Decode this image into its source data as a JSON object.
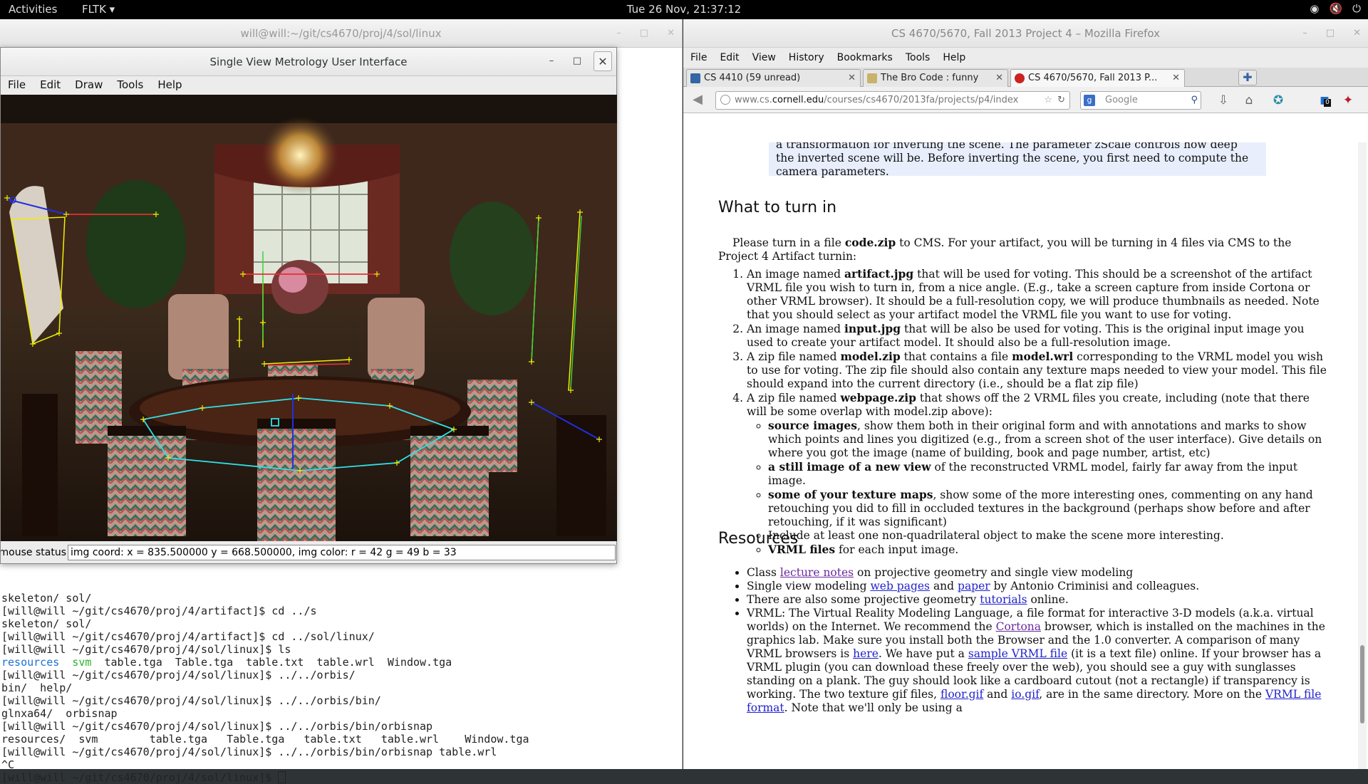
{
  "topbar": {
    "activities": "Activities",
    "app_menu": "FLTK ▾",
    "clock": "Tue 26 Nov, 21:37:12",
    "tray": [
      "◉",
      "🔇",
      "⏻"
    ]
  },
  "terminal": {
    "title": "will@will:~/git/cs4670/proj/4/sol/linux",
    "lines": [
      {
        "segs": [
          {
            "t": "skeleton/ sol/"
          }
        ]
      },
      {
        "segs": [
          {
            "t": "[will@will ~/git/cs4670/proj/4/artifact]$ cd ../s"
          }
        ]
      },
      {
        "segs": [
          {
            "t": "skeleton/ sol/"
          }
        ]
      },
      {
        "segs": [
          {
            "t": "[will@will ~/git/cs4670/proj/4/artifact]$ cd ../sol/linux/"
          }
        ]
      },
      {
        "segs": [
          {
            "t": "[will@will ~/git/cs4670/proj/4/sol/linux]$ ls"
          }
        ]
      },
      {
        "segs": [
          {
            "t": "resources",
            "c": "blue"
          },
          {
            "t": "  "
          },
          {
            "t": "svm",
            "c": "green"
          },
          {
            "t": "  table.tga  Table.tga  table.txt  table.wrl  Window.tga"
          }
        ]
      },
      {
        "segs": [
          {
            "t": "[will@will ~/git/cs4670/proj/4/sol/linux]$ ../../orbis/"
          }
        ]
      },
      {
        "segs": [
          {
            "t": "bin/  help/"
          }
        ]
      },
      {
        "segs": [
          {
            "t": "[will@will ~/git/cs4670/proj/4/sol/linux]$ ../../orbis/bin/"
          }
        ]
      },
      {
        "segs": [
          {
            "t": "glnxa64/  orbisnap"
          }
        ]
      },
      {
        "segs": [
          {
            "t": "[will@will ~/git/cs4670/proj/4/sol/linux]$ ../../orbis/bin/orbisnap"
          }
        ]
      },
      {
        "segs": [
          {
            "t": "resources/  svm        table.tga   Table.tga   table.txt   table.wrl    Window.tga"
          }
        ]
      },
      {
        "segs": [
          {
            "t": "[will@will ~/git/cs4670/proj/4/sol/linux]$ ../../orbis/bin/orbisnap table.wrl"
          }
        ]
      },
      {
        "segs": [
          {
            "t": "^C"
          }
        ]
      },
      {
        "segs": [
          {
            "t": "[will@will ~/git/cs4670/proj/4/sol/linux]$ "
          }
        ],
        "cursor": true
      }
    ]
  },
  "svm": {
    "title": "Single View Metrology User Interface",
    "menu": [
      "File",
      "Edit",
      "Draw",
      "Tools",
      "Help"
    ],
    "status_label": "mouse status:",
    "status_value": "img coord: x = 835.500000 y = 668.500000, img color: r = 42 g = 49 b = 33",
    "colors": {
      "wall": "#4a2a1c",
      "window": "#dfe6d8",
      "table": "#2a140c",
      "annot_yellow": "#f0f000",
      "annot_cyan": "#30e0e8",
      "annot_green": "#3cd23c",
      "annot_red": "#e23030",
      "annot_blue": "#2030e0"
    }
  },
  "firefox": {
    "title": "CS 4670/5670, Fall 2013 Project 4 – Mozilla Firefox",
    "menu": [
      "File",
      "Edit",
      "View",
      "History",
      "Bookmarks",
      "Tools",
      "Help"
    ],
    "tabs": [
      {
        "label": "CS 4410 (59 unread)",
        "favcolor": "#3465a4"
      },
      {
        "label": "The Bro Code : funny",
        "favcolor": "#c9b26b"
      },
      {
        "label": "CS 4670/5670, Fall 2013 P...",
        "favcolor": "#cc2222"
      }
    ],
    "url_host": "www.cs.",
    "url_domain": "cornell.edu",
    "url_path": "/courses/cs4670/2013fa/projects/p4/index",
    "search_placeholder": "Google",
    "notify_count": "0",
    "content": {
      "top_note": "a transformation for inverting the scene. The parameter zScale controls how deep the inverted scene will be. Before inverting the scene, you first need to compute the camera parameters.",
      "h_turnin": "What to turn in",
      "turnin_intro_a": "Please turn in a file ",
      "turnin_intro_b": "code.zip",
      "turnin_intro_c": " to CMS. For your artifact, you will be turning in 4 files via CMS to the Project 4 Artifact turnin:",
      "item1_a": "An image named ",
      "item1_b": "artifact.jpg",
      "item1_c": " that will be used for voting. This should be a screenshot of the artifact VRML file you wish to turn in, from a nice angle. (E.g., take a screen capture from inside Cortona or other VRML browser). It should be a full-resolution copy, we will produce thumbnails as needed. Note that you should select as your artifact model the VRML file you want to use for voting.",
      "item2_a": "An image named ",
      "item2_b": "input.jpg",
      "item2_c": " that will be also be used for voting. This is the original input image you used to create your artifact model. It should also be a full-resolution image.",
      "item3_a": "A zip file named ",
      "item3_b": "model.zip",
      "item3_c": " that contains a file ",
      "item3_d": "model.wrl",
      "item3_e": " corresponding to the VRML model you wish to use for voting. The zip file should also contain any texture maps needed to view your model. This file should expand into the current directory (i.e., should be a flat zip file)",
      "item4_a": "A zip file named ",
      "item4_b": "webpage.zip",
      "item4_c": " that shows off the 2 VRML files you create, including (note that there will be some overlap with model.zip above):",
      "sub1_b": "source images",
      "sub1_c": ", show them both in their original form and with annotations and marks to show which points and lines you digitized (e.g., from a screen shot of the user interface). Give details on where you got the image (name of building, book and page number, artist, etc)",
      "sub2_b": "a still image of a new view",
      "sub2_c": " of the reconstructed VRML model, fairly far away from the input image.",
      "sub3_b": "some of your texture maps",
      "sub3_c": ", show some of the more interesting ones, commenting on any hand retouching you did to fill in occluded textures in the background (perhaps show before and after retouching, if it was significant)",
      "sub4": "Include at least one non-quadrilateral object to make the scene more interesting.",
      "sub5_b": "VRML files",
      "sub5_c": " for each input image.",
      "h_resources": "Resources",
      "res1_a": "Class ",
      "res1_link": "lecture notes",
      "res1_c": " on projective geometry and single view modeling",
      "res2_a": "Single view modeling ",
      "res2_link1": "web pages",
      "res2_b": " and ",
      "res2_link2": "paper",
      "res2_c": " by Antonio Criminisi and colleagues.",
      "res3_a": "There are also some projective geometry ",
      "res3_link": "tutorials",
      "res3_c": " online.",
      "res4_a": "VRML: The Virtual Reality Modeling Language, a file format for interactive 3-D models (a.k.a. virtual worlds) on the Internet. We recommend the ",
      "res4_link1": "Cortona",
      "res4_b": " browser, which is installed on the machines in the graphics lab. Make sure you install both the Browser and the 1.0 converter. A comparison of many VRML browsers is ",
      "res4_link2": "here",
      "res4_c": ". We have put a ",
      "res4_link3": "sample VRML file",
      "res4_d": " (it is a text file) online. If your browser has a VRML plugin (you can download these freely over the web), you should see a guy with sunglasses standing on a plank. The guy should look like a cardboard cutout (not a rectangle) if transparency is working. The two texture gif files, ",
      "res4_link4": "floor.gif",
      "res4_e": " and ",
      "res4_link5": "io.gif",
      "res4_f": ", are in the same directory. More on the ",
      "res4_link6": "VRML file format",
      "res4_g": ". Note that we'll only be using a"
    }
  }
}
